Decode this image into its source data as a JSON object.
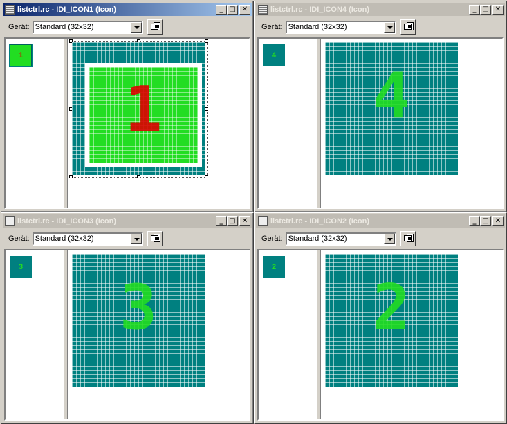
{
  "windows": [
    {
      "title": "listctrl.rc - IDI_ICON1 (Icon)",
      "device_label": "Gerät:",
      "device_value": "Standard (32x32)",
      "digit": "1",
      "preview_text": "1",
      "active": true,
      "colors": {
        "background": "#008080",
        "fill": "#22dd22",
        "digit": "#dd0000"
      }
    },
    {
      "title": "listctrl.rc - IDI_ICON4 (Icon)",
      "device_label": "Gerät:",
      "device_value": "Standard (32x32)",
      "digit": "4",
      "preview_text": "4",
      "active": false
    },
    {
      "title": "listctrl.rc - IDI_ICON3 (Icon)",
      "device_label": "Gerät:",
      "device_value": "Standard (32x32)",
      "digit": "3",
      "preview_text": "3",
      "active": false
    },
    {
      "title": "listctrl.rc - IDI_ICON2 (Icon)",
      "device_label": "Gerät:",
      "device_value": "Standard (32x32)",
      "digit": "2",
      "preview_text": "2",
      "active": false
    }
  ],
  "title_buttons": {
    "minimize": "_",
    "maximize": "□",
    "close": "✕"
  },
  "colors": {
    "teal": "#008080",
    "green": "#22dd22",
    "red": "#dd0000",
    "active_title": "#0a246a"
  }
}
